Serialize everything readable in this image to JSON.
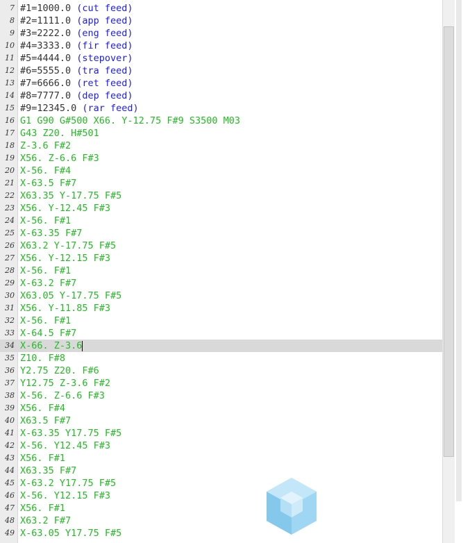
{
  "editor": {
    "current_line": 34,
    "lines": [
      {
        "n": "7",
        "text": "#1=1000.0 ",
        "comment": "(cut feed)",
        "g": false
      },
      {
        "n": "8",
        "text": "#2=1111.0 ",
        "comment": "(app feed)",
        "g": false
      },
      {
        "n": "9",
        "text": "#3=2222.0 ",
        "comment": "(eng feed)",
        "g": false
      },
      {
        "n": "10",
        "text": "#4=3333.0 ",
        "comment": "(fir feed)",
        "g": false
      },
      {
        "n": "11",
        "text": "#5=4444.0 ",
        "comment": "(stepover)",
        "g": false
      },
      {
        "n": "12",
        "text": "#6=5555.0 ",
        "comment": "(tra feed)",
        "g": false
      },
      {
        "n": "13",
        "text": "#7=6666.0 ",
        "comment": "(ret feed)",
        "g": false
      },
      {
        "n": "14",
        "text": "#8=7777.0 ",
        "comment": "(dep feed)",
        "g": false
      },
      {
        "n": "15",
        "text": "#9=12345.0 ",
        "comment": "(rar feed)",
        "g": false
      },
      {
        "n": "16",
        "text": "G1 G90 G#500 X66. Y-12.75 F#9 S3500 M03",
        "comment": "",
        "g": true
      },
      {
        "n": "17",
        "text": "G43 Z20. H#501",
        "comment": "",
        "g": true
      },
      {
        "n": "18",
        "text": "Z-3.6 F#2",
        "comment": "",
        "g": true
      },
      {
        "n": "19",
        "text": "X56. Z-6.6 F#3",
        "comment": "",
        "g": true
      },
      {
        "n": "20",
        "text": "X-56. F#4",
        "comment": "",
        "g": true
      },
      {
        "n": "21",
        "text": "X-63.5 F#7",
        "comment": "",
        "g": true
      },
      {
        "n": "22",
        "text": "X63.35 Y-17.75 F#5",
        "comment": "",
        "g": true
      },
      {
        "n": "23",
        "text": "X56. Y-12.45 F#3",
        "comment": "",
        "g": true
      },
      {
        "n": "24",
        "text": "X-56. F#1",
        "comment": "",
        "g": true
      },
      {
        "n": "25",
        "text": "X-63.35 F#7",
        "comment": "",
        "g": true
      },
      {
        "n": "26",
        "text": "X63.2 Y-17.75 F#5",
        "comment": "",
        "g": true
      },
      {
        "n": "27",
        "text": "X56. Y-12.15 F#3",
        "comment": "",
        "g": true
      },
      {
        "n": "28",
        "text": "X-56. F#1",
        "comment": "",
        "g": true
      },
      {
        "n": "29",
        "text": "X-63.2 F#7",
        "comment": "",
        "g": true
      },
      {
        "n": "30",
        "text": "X63.05 Y-17.75 F#5",
        "comment": "",
        "g": true
      },
      {
        "n": "31",
        "text": "X56. Y-11.85 F#3",
        "comment": "",
        "g": true
      },
      {
        "n": "32",
        "text": "X-56. F#1",
        "comment": "",
        "g": true
      },
      {
        "n": "33",
        "text": "X-64.5 F#7",
        "comment": "",
        "g": true
      },
      {
        "n": "34",
        "text": "X-66. Z-3.6",
        "comment": "",
        "g": true
      },
      {
        "n": "35",
        "text": "Z10. F#8",
        "comment": "",
        "g": true
      },
      {
        "n": "36",
        "text": "Y2.75 Z20. F#6",
        "comment": "",
        "g": true
      },
      {
        "n": "37",
        "text": "Y12.75 Z-3.6 F#2",
        "comment": "",
        "g": true
      },
      {
        "n": "38",
        "text": "X-56. Z-6.6 F#3",
        "comment": "",
        "g": true
      },
      {
        "n": "39",
        "text": "X56. F#4",
        "comment": "",
        "g": true
      },
      {
        "n": "40",
        "text": "X63.5 F#7",
        "comment": "",
        "g": true
      },
      {
        "n": "41",
        "text": "X-63.35 Y17.75 F#5",
        "comment": "",
        "g": true
      },
      {
        "n": "42",
        "text": "X-56. Y12.45 F#3",
        "comment": "",
        "g": true
      },
      {
        "n": "43",
        "text": "X56. F#1",
        "comment": "",
        "g": true
      },
      {
        "n": "44",
        "text": "X63.35 F#7",
        "comment": "",
        "g": true
      },
      {
        "n": "45",
        "text": "X-63.2 Y17.75 F#5",
        "comment": "",
        "g": true
      },
      {
        "n": "46",
        "text": "X-56. Y12.15 F#3",
        "comment": "",
        "g": true
      },
      {
        "n": "47",
        "text": "X56. F#1",
        "comment": "",
        "g": true
      },
      {
        "n": "48",
        "text": "X63.2 F#7",
        "comment": "",
        "g": true
      },
      {
        "n": "49",
        "text": "X-63.05 Y17.75 F#5",
        "comment": "",
        "g": true
      }
    ]
  },
  "scrollbar": {
    "orientation": "vertical"
  },
  "watermark": {
    "icon": "cube-logo-icon",
    "color": "#7ec8f0"
  },
  "colors": {
    "code_green": "#22bb22",
    "comment_blue": "#1a1aff",
    "text_dark": "#333333",
    "current_line_bg": "#d9d9d9"
  }
}
